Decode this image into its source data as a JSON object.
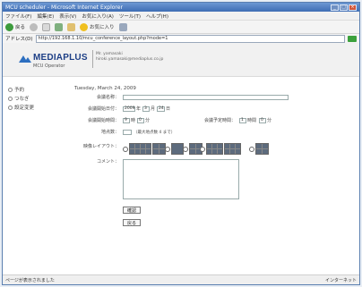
{
  "window": {
    "title": "MCU scheduler - Microsoft Internet Explorer"
  },
  "menu": [
    "ファイル(F)",
    "編集(E)",
    "表示(V)",
    "お気に入り(A)",
    "ツール(T)",
    "ヘルプ(H)"
  ],
  "toolbar": {
    "back_label": "戻る",
    "search_label": "",
    "favorites_label": "お気に入り"
  },
  "address": {
    "label": "アドレス(D)",
    "url": "http://192.168.1.10/mcu_conference_layout.php?mode=1"
  },
  "header": {
    "logo_text": "MEDIAPLUS",
    "logo_subtitle": "MCU Operator",
    "user_line1": "Mr. yamasaki",
    "user_line2": "hiroki.yamasaki@mediaplus.co.jp"
  },
  "sidebar": {
    "items": [
      "予約",
      "つなぎ",
      "設定変更"
    ]
  },
  "main": {
    "date": "Tuesday, March 24, 2009",
    "conference_name_label": "会議名称：",
    "start_date_label": "会議開始日付：",
    "start_year": "2009",
    "start_month": "3",
    "start_day": "24",
    "year_unit": "年",
    "month_unit": "月",
    "day_unit": "日",
    "start_time_label": "会議開始時間：",
    "start_hour": "9",
    "start_minute": "0",
    "hour_unit": "時",
    "minute_unit": "分",
    "duration_label": "会議予定時間：",
    "duration_hour": "1",
    "duration_minute": "0",
    "duration_hour_unit": "時間",
    "participants_label": "地点数：",
    "participants_note": "（最大地点数 4 まで）",
    "layout_label": "映像レイアウト：",
    "comment_label": "コメント：",
    "confirm_button": "確認",
    "back_button": "戻る"
  },
  "status": {
    "left": "ページが表示されました",
    "right": "インターネット"
  },
  "colors": {
    "titlebar": "#3e6db4",
    "logo": "#1d3f86",
    "layout_cell": "#5d6b7d"
  }
}
